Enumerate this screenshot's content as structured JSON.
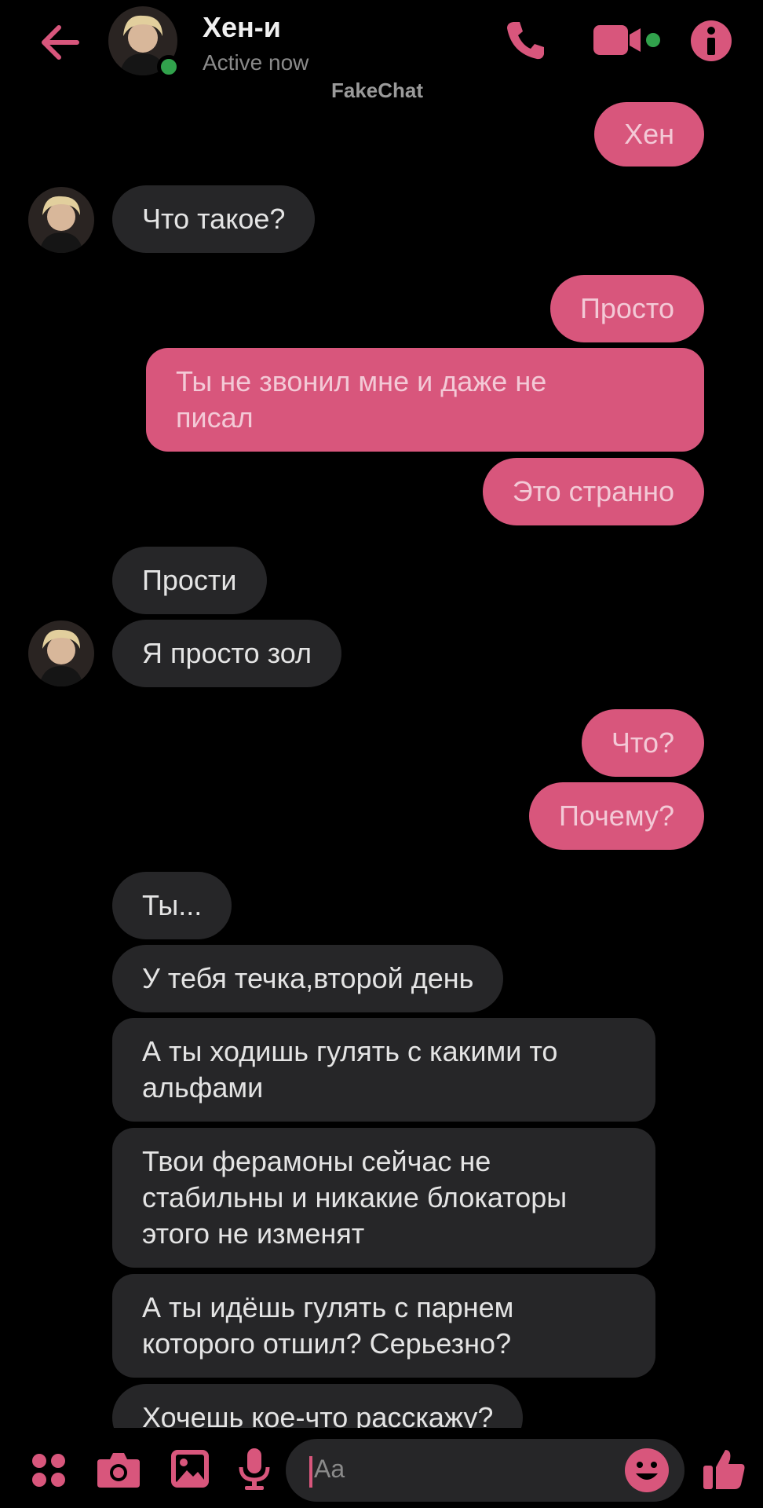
{
  "header": {
    "name": "Хен-и",
    "status": "Active now",
    "watermark": "FakeChat"
  },
  "messages": [
    {
      "from": "me",
      "text": "Хен"
    },
    {
      "from": "them",
      "text": "Что такое?"
    },
    {
      "from": "me",
      "text": "Просто"
    },
    {
      "from": "me",
      "text": "Ты не звонил мне и даже не\nписал"
    },
    {
      "from": "me",
      "text": "Это странно"
    },
    {
      "from": "them",
      "text": "Прости"
    },
    {
      "from": "them",
      "text": "Я просто зол"
    },
    {
      "from": "me",
      "text": "Что?"
    },
    {
      "from": "me",
      "text": "Почему?"
    },
    {
      "from": "them",
      "text": "Ты..."
    },
    {
      "from": "them",
      "text": "У тебя течка,второй день"
    },
    {
      "from": "them",
      "text": "А ты ходишь гулять с какими то\nальфами"
    },
    {
      "from": "them",
      "text": "Твои ферамоны сейчас не\nстабильны и никакие блокаторы\nэтого не изменят"
    },
    {
      "from": "them",
      "text": "А ты идёшь гулять с парнем\nкоторого отшил? Серьезно?"
    },
    {
      "from": "them",
      "text": "Хочешь кое-что расскажу?"
    }
  ],
  "composer": {
    "placeholder": "Aa"
  },
  "colors": {
    "accent": "#d8567c",
    "incoming_bubble": "#262628",
    "background": "#000000",
    "online": "#31a24c"
  },
  "icons": [
    "back-arrow-icon",
    "phone-icon",
    "video-camera-icon",
    "info-icon",
    "apps-grid-icon",
    "camera-icon",
    "gallery-icon",
    "microphone-icon",
    "emoji-icon",
    "thumbs-up-icon"
  ]
}
